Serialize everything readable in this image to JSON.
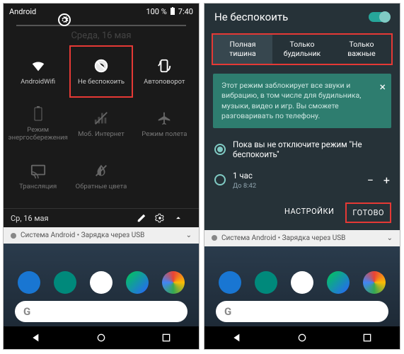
{
  "left": {
    "statusbar": {
      "carrier": "Android",
      "battery": "100 %",
      "time": "7:40"
    },
    "date_faint": "Среда, 16 мая",
    "tiles": [
      {
        "label": "AndroidWifi",
        "icon": "wifi"
      },
      {
        "label": "Не беспокоить",
        "icon": "dnd",
        "highlight": true
      },
      {
        "label": "Автоповорот",
        "icon": "rotate"
      },
      {
        "label": "Режим\nэнергосбережения",
        "icon": "battery",
        "dim": true
      },
      {
        "label": "Моб. Интернет",
        "icon": "data",
        "dim": true
      },
      {
        "label": "Режим полета",
        "icon": "airplane",
        "dim": true
      },
      {
        "label": "Трансляция",
        "icon": "cast",
        "dim": true
      },
      {
        "label": "Обратные цвета",
        "icon": "invert",
        "dim": true
      }
    ],
    "footer_date": "Ср, 16 мая",
    "notif": "Система Android • Зарядка через USB",
    "search_letter": "G"
  },
  "right": {
    "title": "Не беспокоить",
    "tabs": [
      {
        "l1": "Полная",
        "l2": "тишина",
        "active": true
      },
      {
        "l1": "Только",
        "l2": "будильник"
      },
      {
        "l1": "Только",
        "l2": "важные"
      }
    ],
    "info": "Этот режим заблокирует все звуки и вибрацию, в том числе для будильника, музыки, видео и игр. Вы сможете разговаривать по телефону.",
    "opt1": "Пока вы не отключите режим \"Не беспокоить\"",
    "opt2_main": "1 час",
    "opt2_sub": "До 8:42",
    "btn_settings": "НАСТРОЙКИ",
    "btn_done": "ГОТОВО",
    "notif": "Система Android • Зарядка через USB",
    "search_letter": "G"
  }
}
